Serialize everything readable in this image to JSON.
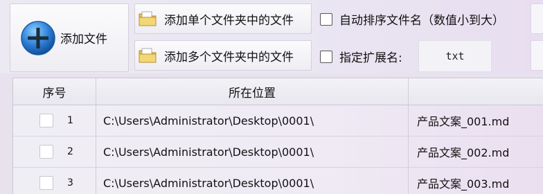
{
  "toolbar": {
    "add_files_label": "添加文件",
    "add_single_folder_label": "添加单个文件夹中的文件",
    "add_multi_folder_label": "添加多个文件夹中的文件",
    "auto_sort_label": "自动排序文件名（数值小到大）",
    "ext_label": "指定扩展名:",
    "ext_value": "txt"
  },
  "table": {
    "headers": [
      "序号",
      "所在位置",
      ""
    ],
    "rows": [
      {
        "index": "1",
        "path": "C:\\Users\\Administrator\\Desktop\\0001\\",
        "name": "产品文案_001.md"
      },
      {
        "index": "2",
        "path": "C:\\Users\\Administrator\\Desktop\\0001\\",
        "name": "产品文案_002.md"
      },
      {
        "index": "3",
        "path": "C:\\Users\\Administrator\\Desktop\\0001\\",
        "name": "产品文案_003.md"
      }
    ]
  },
  "colors": {
    "accent_blue": "#2b7fd6",
    "folder_yellow": "#e9c04a"
  }
}
